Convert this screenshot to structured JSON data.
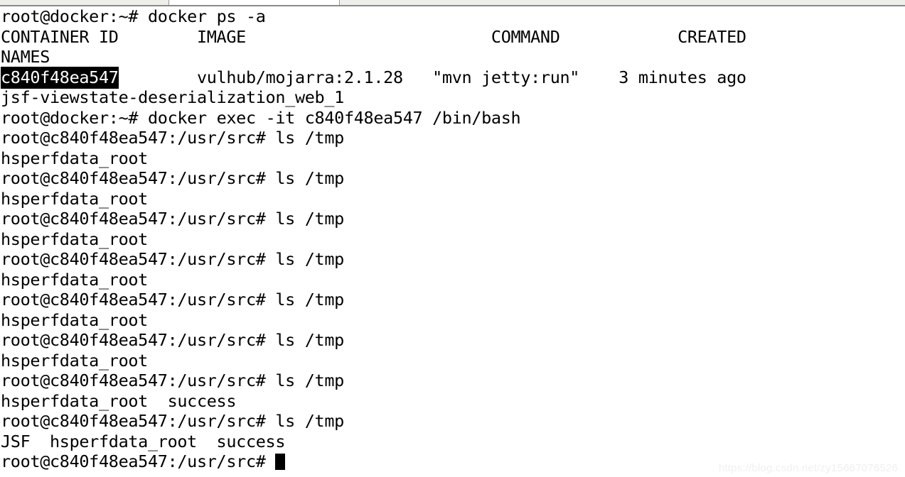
{
  "window": {
    "type": "terminal-emulator",
    "background_color": "#ffffff",
    "foreground_color": "#000000",
    "tabbar": {
      "tab1_label": "",
      "tab2_label": "",
      "tab3_label": ""
    }
  },
  "watermark": {
    "text": "https://blog.csdn.net/zy15667076526"
  },
  "terminal": {
    "host_prompt": "root@docker:~#",
    "container_prompt": "root@c840f48ea547:/usr/src#",
    "container_id": "c840f48ea547",
    "selection": {
      "text": "c840f48ea547",
      "background": "#000000",
      "foreground": "#ffffff"
    },
    "cursor": {
      "shape": "block",
      "color": "#000000"
    },
    "docker_ps": {
      "command": "docker ps -a",
      "headers": [
        "CONTAINER ID",
        "IMAGE",
        "COMMAND",
        "CREATED"
      ],
      "headers_wrapped": "NAMES",
      "row": {
        "container_id": "c840f48ea547",
        "image": "vulhub/mojarra:2.1.28",
        "command": "\"mvn jetty:run\"",
        "created": "3 minutes ago",
        "names": "jsf-viewstate-deserialization_web_1"
      }
    },
    "exec_command": "docker exec -it c840f48ea547 /bin/bash",
    "ls_command": "ls /tmp",
    "lines": [
      {
        "id": "l01",
        "kind": "prompt-command",
        "prompt": "root@docker:~# ",
        "text": "docker ps -a"
      },
      {
        "id": "l02",
        "kind": "header",
        "text": "CONTAINER ID        IMAGE                         COMMAND            CREATED"
      },
      {
        "id": "l03",
        "kind": "header",
        "text": "NAMES"
      },
      {
        "id": "l04",
        "kind": "row-selected",
        "selected": "c840f48ea547",
        "rest": "        vulhub/mojarra:2.1.28   \"mvn jetty:run\"    3 minutes ago"
      },
      {
        "id": "l05",
        "kind": "output",
        "text": "jsf-viewstate-deserialization_web_1"
      },
      {
        "id": "l06",
        "kind": "prompt-command",
        "prompt": "root@docker:~# ",
        "text": "docker exec -it c840f48ea547 /bin/bash"
      },
      {
        "id": "l07",
        "kind": "prompt-command",
        "prompt": "root@c840f48ea547:/usr/src# ",
        "text": "ls /tmp"
      },
      {
        "id": "l08",
        "kind": "output",
        "text": "hsperfdata_root"
      },
      {
        "id": "l09",
        "kind": "prompt-command",
        "prompt": "root@c840f48ea547:/usr/src# ",
        "text": "ls /tmp"
      },
      {
        "id": "l10",
        "kind": "output",
        "text": "hsperfdata_root"
      },
      {
        "id": "l11",
        "kind": "prompt-command",
        "prompt": "root@c840f48ea547:/usr/src# ",
        "text": "ls /tmp"
      },
      {
        "id": "l12",
        "kind": "output",
        "text": "hsperfdata_root"
      },
      {
        "id": "l13",
        "kind": "prompt-command",
        "prompt": "root@c840f48ea547:/usr/src# ",
        "text": "ls /tmp"
      },
      {
        "id": "l14",
        "kind": "output",
        "text": "hsperfdata_root"
      },
      {
        "id": "l15",
        "kind": "prompt-command",
        "prompt": "root@c840f48ea547:/usr/src# ",
        "text": "ls /tmp"
      },
      {
        "id": "l16",
        "kind": "output",
        "text": "hsperfdata_root"
      },
      {
        "id": "l17",
        "kind": "prompt-command",
        "prompt": "root@c840f48ea547:/usr/src# ",
        "text": "ls /tmp"
      },
      {
        "id": "l18",
        "kind": "output",
        "text": "hsperfdata_root"
      },
      {
        "id": "l19",
        "kind": "prompt-command",
        "prompt": "root@c840f48ea547:/usr/src# ",
        "text": "ls /tmp"
      },
      {
        "id": "l20",
        "kind": "output",
        "text": "hsperfdata_root  success"
      },
      {
        "id": "l21",
        "kind": "prompt-command",
        "prompt": "root@c840f48ea547:/usr/src# ",
        "text": "ls /tmp"
      },
      {
        "id": "l22",
        "kind": "output",
        "text": "JSF  hsperfdata_root  success"
      },
      {
        "id": "l23",
        "kind": "prompt-cursor",
        "prompt": "root@c840f48ea547:/usr/src# ",
        "text": ""
      }
    ]
  }
}
